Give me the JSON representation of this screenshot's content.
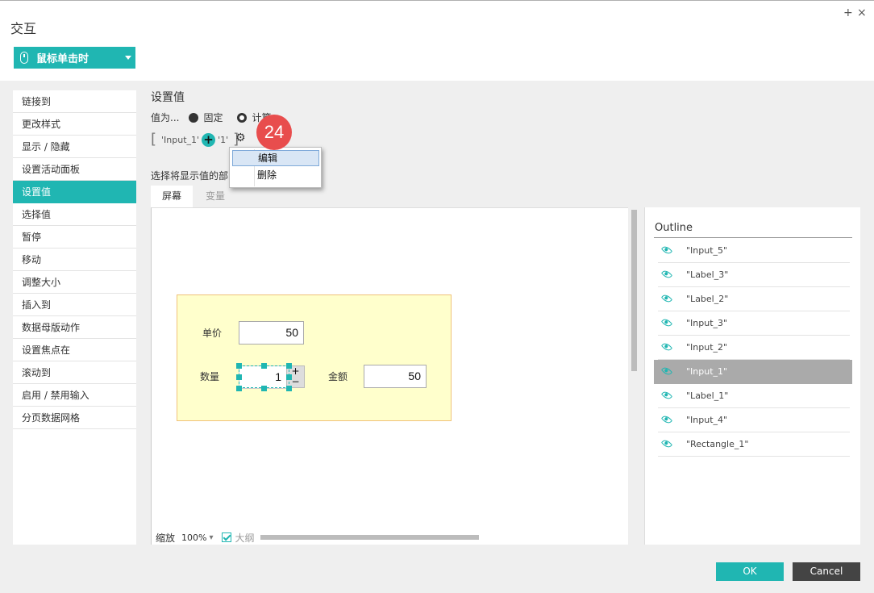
{
  "window": {
    "title": "交互",
    "add_glyph": "+",
    "close_glyph": "×"
  },
  "trigger": {
    "label": "鼠标单击时",
    "icon": "mouse-icon"
  },
  "actions": [
    "链接到",
    "更改样式",
    "显示 / 隐藏",
    "设置活动面板",
    "设置值",
    "选择值",
    "暂停",
    "移动",
    "调整大小",
    "插入到",
    "数据母版动作",
    "设置焦点在",
    "滚动到",
    "启用 / 禁用输入",
    "分页数据网格"
  ],
  "active_action_index": 4,
  "panel": {
    "title": "设置值",
    "value_as": "值为...",
    "option_fixed": "固定",
    "option_calc": "计算",
    "expr_left": "'Input_1'",
    "expr_right": "'1'",
    "plus_glyph": "+",
    "gear_glyph": "⚙",
    "badge": "24",
    "select_label": "选择将显示值的部"
  },
  "context_menu": {
    "items": [
      "编辑",
      "删除"
    ],
    "highlighted_index": 0
  },
  "tabs": {
    "screen": "屏幕",
    "variable": "变量"
  },
  "canvas": {
    "unit_price_label": "单价",
    "unit_price_value": "50",
    "qty_label": "数量",
    "qty_value": "1",
    "stepper_plus": "+",
    "stepper_minus": "−",
    "amount_label": "金额",
    "amount_value": "50"
  },
  "bottom": {
    "zoom_label": "缩放",
    "zoom_value": "100%",
    "zoom_caret": "▾",
    "outline_toggle": "大纲"
  },
  "outline": {
    "title": "Outline",
    "items": [
      "\"Input_5\"",
      "\"Label_3\"",
      "\"Label_2\"",
      "\"Input_3\"",
      "\"Input_2\"",
      "\"Input_1\"",
      "\"Label_1\"",
      "\"Input_4\"",
      "\"Rectangle_1\""
    ],
    "selected_index": 5
  },
  "buttons": {
    "ok": "OK",
    "cancel": "Cancel"
  },
  "colors": {
    "accent": "#20b6b2",
    "badge": "#e84d4d",
    "cancel": "#444444",
    "selected_row": "#aaaaaa"
  }
}
